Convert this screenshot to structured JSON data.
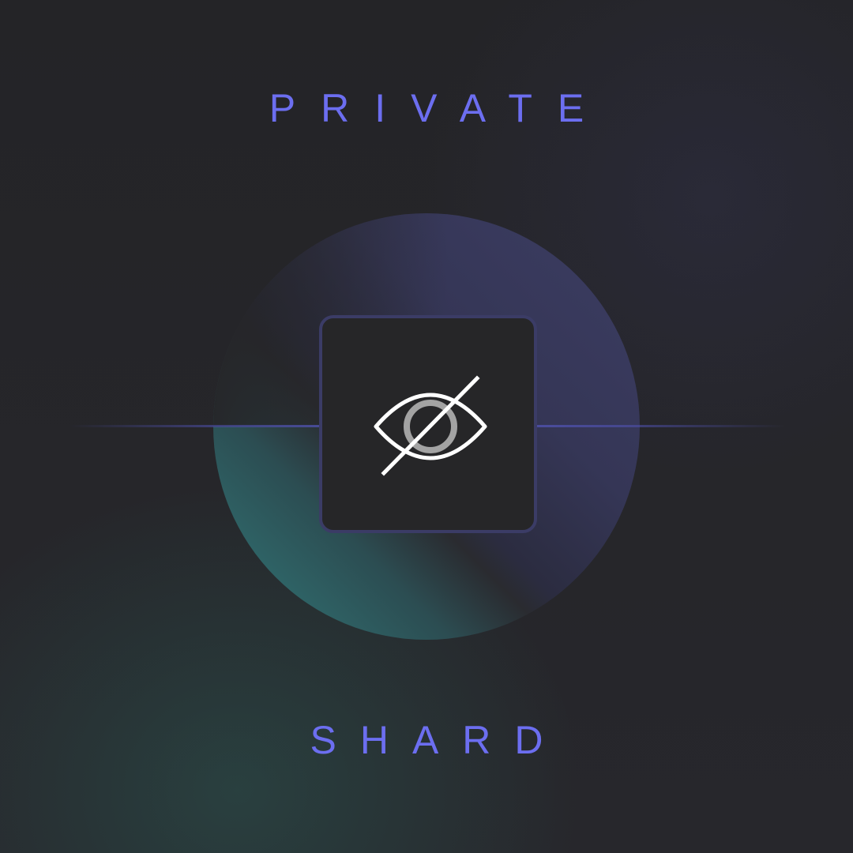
{
  "title": "PRIVATE",
  "subtitle": "SHARD",
  "icon": {
    "name": "eye-slash-icon"
  },
  "colors": {
    "accent": "#6c6ef0",
    "background": "#252528",
    "card_border": "#3b3c66",
    "card_fill": "#262628",
    "teal": "#2f6a6c",
    "indigo": "#3c3d63"
  }
}
